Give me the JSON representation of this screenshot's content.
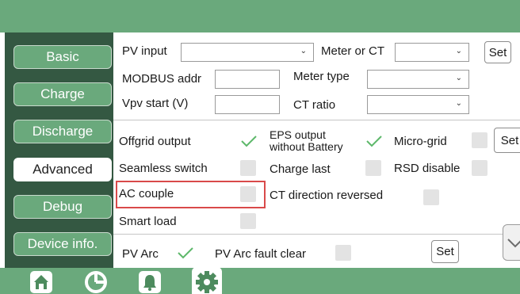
{
  "sidebar": {
    "items": [
      {
        "label": "Basic"
      },
      {
        "label": "Charge"
      },
      {
        "label": "Discharge"
      },
      {
        "label": "Advanced",
        "active": true
      },
      {
        "label": "Debug"
      },
      {
        "label": "Device info."
      }
    ]
  },
  "section1": {
    "pv_input_label": "PV input",
    "pv_input_value": "",
    "meter_or_ct_label": "Meter or CT",
    "meter_or_ct_value": "",
    "set_label": "Set",
    "modbus_addr_label": "MODBUS addr",
    "modbus_addr_value": "",
    "meter_type_label": "Meter type",
    "meter_type_value": "",
    "vpv_start_label": "Vpv start (V)",
    "vpv_start_value": "",
    "ct_ratio_label": "CT ratio",
    "ct_ratio_value": ""
  },
  "section2": {
    "offgrid_output_label": "Offgrid output",
    "offgrid_output_checked": true,
    "eps_output_label_line1": "EPS output",
    "eps_output_label_line2": "without Battery",
    "eps_output_checked": true,
    "micro_grid_label": "Micro-grid",
    "micro_grid_checked": false,
    "set_label": "Set",
    "seamless_switch_label": "Seamless switch",
    "seamless_switch_checked": false,
    "charge_last_label": "Charge last",
    "charge_last_checked": false,
    "rsd_disable_label": "RSD disable",
    "rsd_disable_checked": false,
    "ac_couple_label": "AC couple",
    "ac_couple_checked": false,
    "ct_direction_reversed_label": "CT direction reversed",
    "ct_direction_reversed_checked": false,
    "smart_load_label": "Smart load",
    "smart_load_checked": false
  },
  "section3": {
    "pv_arc_label": "PV Arc",
    "pv_arc_checked": true,
    "pv_arc_fault_clear_label": "PV Arc fault clear",
    "pv_arc_fault_clear_checked": false,
    "set_label": "Set"
  },
  "bottom_nav": {
    "icons": [
      "home-icon",
      "pie-chart-icon",
      "alarm-bell-icon",
      "settings-gear-icon"
    ],
    "active": "settings-gear-icon"
  },
  "colors": {
    "topbar": "#6aa97c",
    "sidebar": "#345842",
    "check": "#5db86a",
    "highlight": "#d94a4a"
  }
}
